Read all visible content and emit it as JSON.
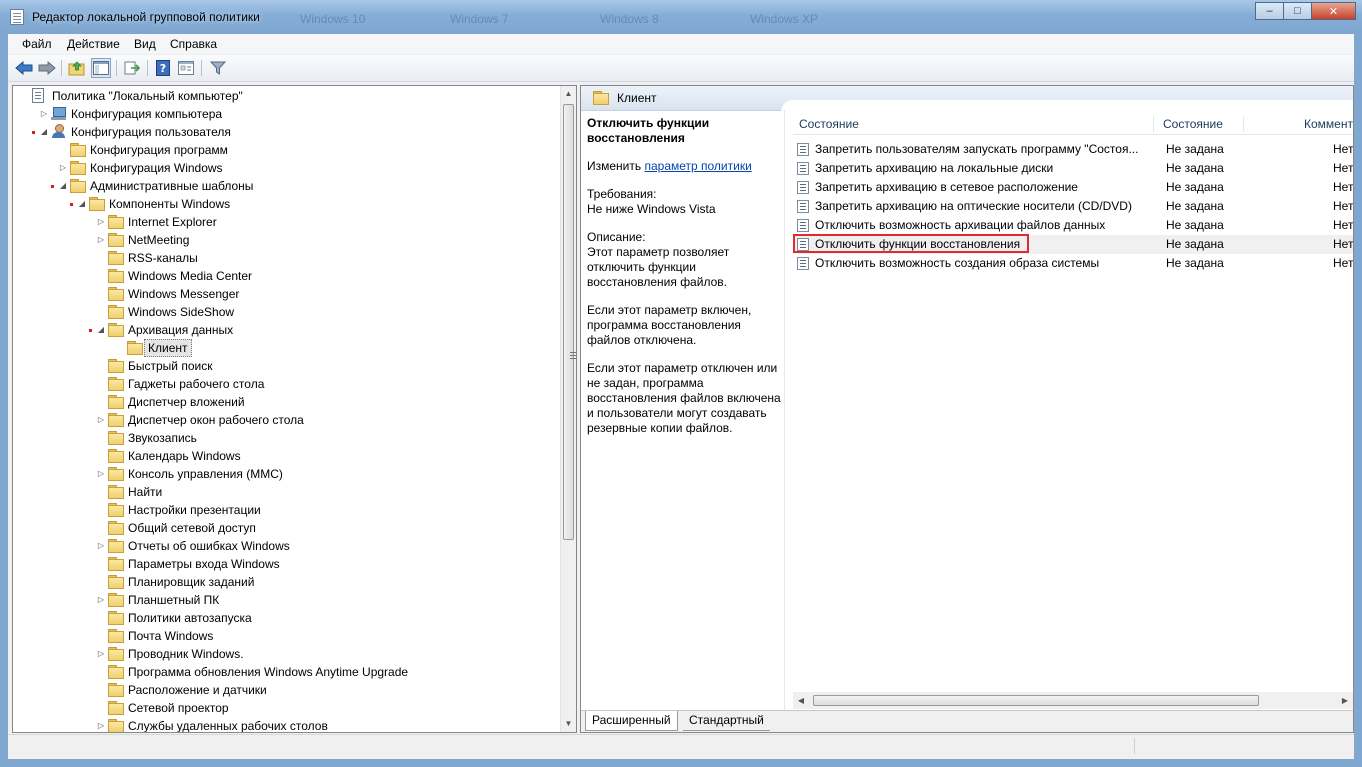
{
  "window": {
    "title": "Редактор локальной групповой политики",
    "ghost_titles": [
      "Windows 10",
      "Windows 7",
      "Windows 8",
      "Windows XP"
    ],
    "caption_buttons": {
      "minimize": "–",
      "maximize": "□",
      "close": "✕"
    }
  },
  "menu": [
    "Файл",
    "Действие",
    "Вид",
    "Справка"
  ],
  "toolbar": {
    "icons": [
      "back-arrow-icon",
      "forward-arrow-icon",
      "up-folder-icon",
      "show-hide-tree-icon",
      "export-list-icon",
      "help-icon",
      "properties-icon",
      "filter-icon"
    ]
  },
  "tree": [
    {
      "label": "Политика \"Локальный компьютер\"",
      "level": 0,
      "icon": "policy-root-icon",
      "arrow": ""
    },
    {
      "label": "Конфигурация компьютера",
      "level": 1,
      "icon": "computer-icon",
      "arrow": "collapsed"
    },
    {
      "label": "Конфигурация пользователя",
      "level": 1,
      "icon": "user-icon",
      "arrow": "expanded",
      "dot": true
    },
    {
      "label": "Конфигурация программ",
      "level": 2,
      "icon": "folder-icon",
      "arrow": ""
    },
    {
      "label": "Конфигурация Windows",
      "level": 2,
      "icon": "folder-icon",
      "arrow": "collapsed"
    },
    {
      "label": "Административные шаблоны",
      "level": 2,
      "icon": "folder-icon",
      "arrow": "expanded",
      "dot": true
    },
    {
      "label": "Компоненты Windows",
      "level": 3,
      "icon": "folder-icon",
      "arrow": "expanded",
      "dot": true
    },
    {
      "label": "Internet Explorer",
      "level": 4,
      "icon": "folder-icon",
      "arrow": "collapsed"
    },
    {
      "label": "NetMeeting",
      "level": 4,
      "icon": "folder-icon",
      "arrow": "collapsed"
    },
    {
      "label": "RSS-каналы",
      "level": 4,
      "icon": "folder-icon",
      "arrow": ""
    },
    {
      "label": "Windows Media Center",
      "level": 4,
      "icon": "folder-icon",
      "arrow": ""
    },
    {
      "label": "Windows Messenger",
      "level": 4,
      "icon": "folder-icon",
      "arrow": ""
    },
    {
      "label": "Windows SideShow",
      "level": 4,
      "icon": "folder-icon",
      "arrow": ""
    },
    {
      "label": "Архивация данных",
      "level": 4,
      "icon": "folder-icon",
      "arrow": "expanded",
      "dot": true
    },
    {
      "label": "Клиент",
      "level": 5,
      "icon": "folder-icon",
      "arrow": "",
      "selected": true
    },
    {
      "label": "Быстрый поиск",
      "level": 4,
      "icon": "folder-icon",
      "arrow": ""
    },
    {
      "label": "Гаджеты рабочего стола",
      "level": 4,
      "icon": "folder-icon",
      "arrow": ""
    },
    {
      "label": "Диспетчер вложений",
      "level": 4,
      "icon": "folder-icon",
      "arrow": ""
    },
    {
      "label": "Диспетчер окон рабочего стола",
      "level": 4,
      "icon": "folder-icon",
      "arrow": "collapsed"
    },
    {
      "label": "Звукозапись",
      "level": 4,
      "icon": "folder-icon",
      "arrow": ""
    },
    {
      "label": "Календарь Windows",
      "level": 4,
      "icon": "folder-icon",
      "arrow": ""
    },
    {
      "label": "Консоль управления (MMC)",
      "level": 4,
      "icon": "folder-icon",
      "arrow": "collapsed"
    },
    {
      "label": "Найти",
      "level": 4,
      "icon": "folder-icon",
      "arrow": ""
    },
    {
      "label": "Настройки презентации",
      "level": 4,
      "icon": "folder-icon",
      "arrow": ""
    },
    {
      "label": "Общий сетевой доступ",
      "level": 4,
      "icon": "folder-icon",
      "arrow": ""
    },
    {
      "label": "Отчеты об ошибках Windows",
      "level": 4,
      "icon": "folder-icon",
      "arrow": "collapsed"
    },
    {
      "label": "Параметры входа Windows",
      "level": 4,
      "icon": "folder-icon",
      "arrow": ""
    },
    {
      "label": "Планировщик заданий",
      "level": 4,
      "icon": "folder-icon",
      "arrow": ""
    },
    {
      "label": "Планшетный ПК",
      "level": 4,
      "icon": "folder-icon",
      "arrow": "collapsed"
    },
    {
      "label": "Политики автозапуска",
      "level": 4,
      "icon": "folder-icon",
      "arrow": ""
    },
    {
      "label": "Почта Windows",
      "level": 4,
      "icon": "folder-icon",
      "arrow": ""
    },
    {
      "label": "Проводник Windows.",
      "level": 4,
      "icon": "folder-icon",
      "arrow": "collapsed"
    },
    {
      "label": "Программа обновления Windows Anytime Upgrade",
      "level": 4,
      "icon": "folder-icon",
      "arrow": ""
    },
    {
      "label": "Расположение и датчики",
      "level": 4,
      "icon": "folder-icon",
      "arrow": ""
    },
    {
      "label": "Сетевой проектор",
      "level": 4,
      "icon": "folder-icon",
      "arrow": ""
    },
    {
      "label": "Службы удаленных рабочих столов",
      "level": 4,
      "icon": "folder-icon",
      "arrow": "collapsed"
    }
  ],
  "right": {
    "header": "Клиент",
    "description": {
      "title": "Отключить функции восстановления",
      "edit_prefix": "Изменить ",
      "edit_link": "параметр политики",
      "requirements_label": "Требования:",
      "requirements_value": "Не ниже Windows Vista",
      "description_label": "Описание:",
      "paragraphs": [
        "Этот параметр позволяет отключить функции восстановления файлов.",
        "Если этот параметр включен, программа восстановления файлов отключена.",
        "Если этот параметр отключен или не задан, программа восстановления файлов включена и пользователи могут создавать резервные копии файлов."
      ]
    },
    "columns": [
      "Состояние",
      "Состояние",
      "Коммент"
    ],
    "rows": [
      {
        "name": "Запретить пользователям запускать программу \"Состоя...",
        "state": "Не задана",
        "comment": "Нет"
      },
      {
        "name": "Запретить архивацию на локальные диски",
        "state": "Не задана",
        "comment": "Нет"
      },
      {
        "name": "Запретить архивацию в сетевое расположение",
        "state": "Не задана",
        "comment": "Нет"
      },
      {
        "name": "Запретить архивацию на оптические носители (CD/DVD)",
        "state": "Не задана",
        "comment": "Нет"
      },
      {
        "name": "Отключить возможность архивации файлов данных",
        "state": "Не задана",
        "comment": "Нет"
      },
      {
        "name": "Отключить функции восстановления",
        "state": "Не задана",
        "comment": "Нет",
        "highlighted": true
      },
      {
        "name": "Отключить возможность создания образа системы",
        "state": "Не задана",
        "comment": "Нет"
      }
    ],
    "tabs": [
      "Расширенный",
      "Стандартный"
    ]
  }
}
